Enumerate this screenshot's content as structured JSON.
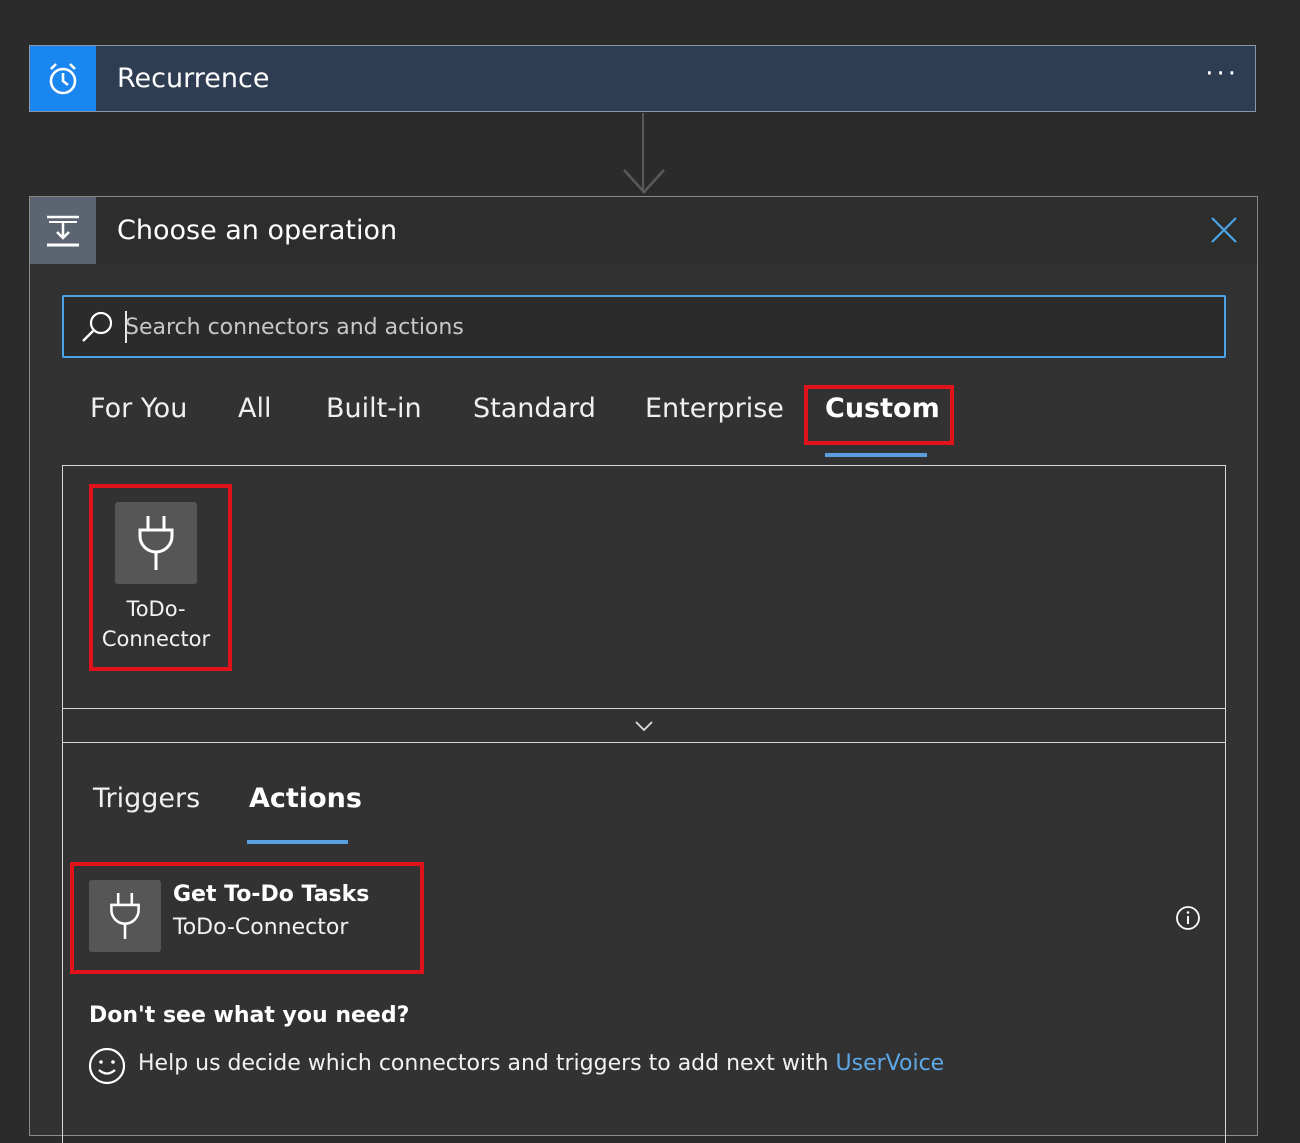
{
  "trigger": {
    "title": "Recurrence",
    "icon": "alarm-clock-icon",
    "more_label": "···",
    "accent": "#1a86ef"
  },
  "operation": {
    "title": "Choose an operation",
    "icon": "insert-operation-icon",
    "search": {
      "placeholder": "Search connectors and actions",
      "value": ""
    },
    "tabs": [
      {
        "label": "For You",
        "active": false
      },
      {
        "label": "All",
        "active": false
      },
      {
        "label": "Built-in",
        "active": false
      },
      {
        "label": "Standard",
        "active": false
      },
      {
        "label": "Enterprise",
        "active": false
      },
      {
        "label": "Custom",
        "active": true
      }
    ],
    "connectors": [
      {
        "label": "ToDo-\nConnector",
        "icon": "plug-icon"
      }
    ],
    "sub_tabs": [
      {
        "label": "Triggers",
        "active": false
      },
      {
        "label": "Actions",
        "active": true
      }
    ],
    "actions": [
      {
        "title": "Get To-Do Tasks",
        "connector": "ToDo-Connector",
        "icon": "plug-icon"
      }
    ],
    "help": {
      "heading": "Don't see what you need?",
      "text": "Help us decide which connectors and triggers to add next with ",
      "link": "UserVoice"
    }
  },
  "colors": {
    "highlight": "#e0131a",
    "tab_underline": "#5aa0e0",
    "link": "#5fa8e8"
  }
}
